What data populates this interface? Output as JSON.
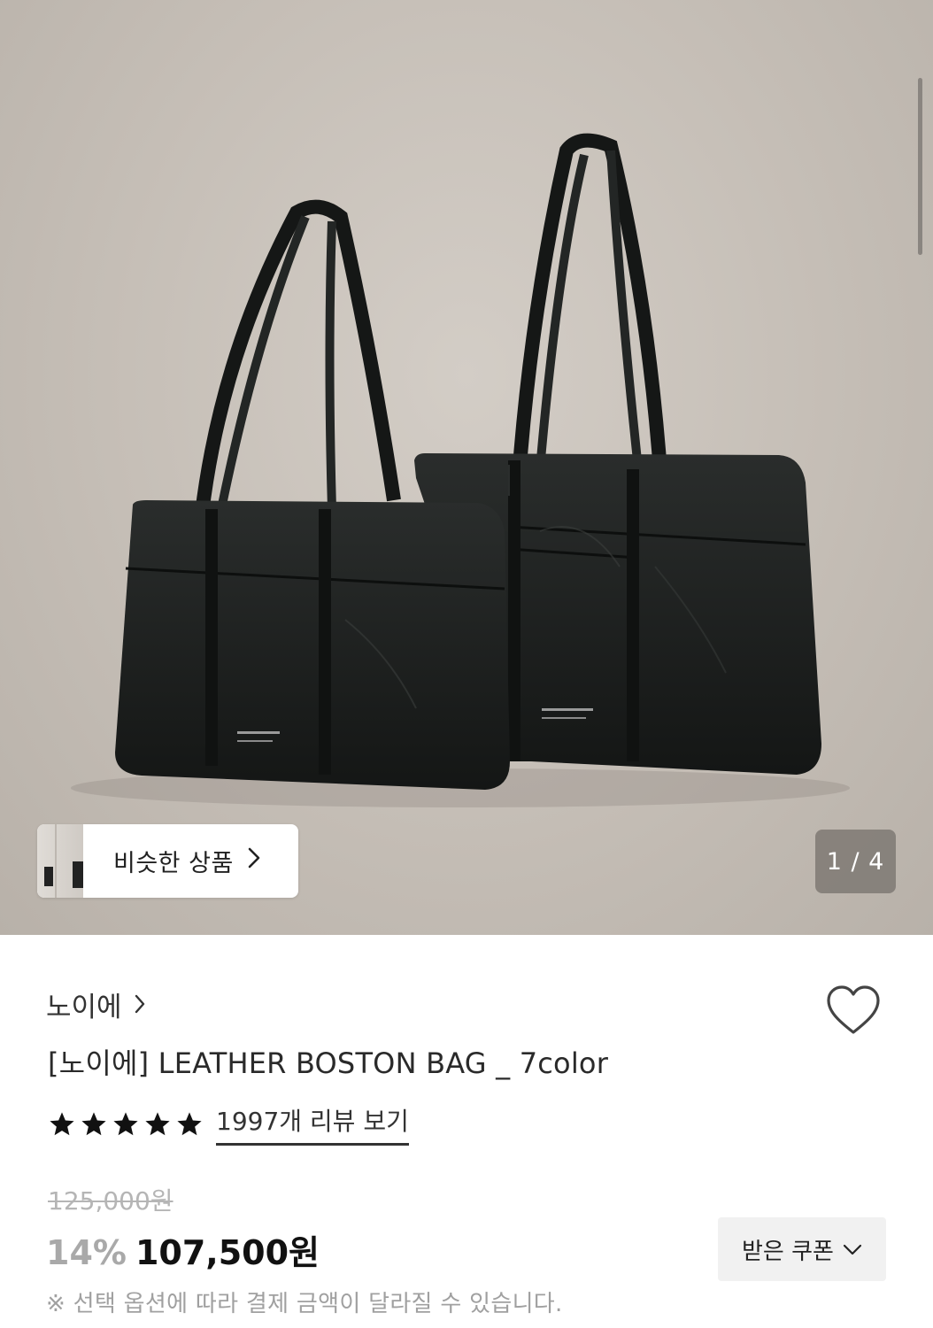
{
  "gallery": {
    "similar_label": "비슷한 상품",
    "counter": "1 / 4",
    "image_alt": "two black leather boston bags"
  },
  "product": {
    "brand": "노이에",
    "title": "[노이에] LEATHER BOSTON BAG _ 7color",
    "rating": 5,
    "reviews_link": "1997개 리뷰 보기",
    "original_price": "125,000원",
    "discount": "14%",
    "sale_price": "107,500원",
    "coupon_label": "받은 쿠폰",
    "notice": "※ 선택 옵션에 따라 결제 금액이 달라질 수 있습니다."
  },
  "icons": {
    "brand_chevron": "chevron-right-icon",
    "heart": "heart-outline-icon",
    "star": "star-filled-icon",
    "coupon_chevron": "chevron-down-icon"
  },
  "colors": {
    "bag": "#1c1f1e",
    "background": "#c8c1b9",
    "price": "#111111",
    "discount": "#a9a9a9"
  }
}
